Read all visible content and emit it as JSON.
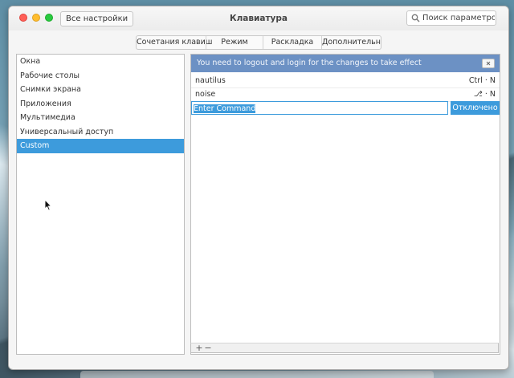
{
  "window": {
    "title": "Клавиатура",
    "back_button": "Все настройки",
    "search_placeholder": "Поиск параметров"
  },
  "tabs": [
    {
      "label": "Сочетания клавиш",
      "selected": true
    },
    {
      "label": "Режим"
    },
    {
      "label": "Раскладка"
    },
    {
      "label": "Дополнительно"
    }
  ],
  "sidebar": {
    "items": [
      {
        "label": "Окна"
      },
      {
        "label": "Рабочие столы"
      },
      {
        "label": "Снимки экрана"
      },
      {
        "label": "Приложения"
      },
      {
        "label": "Мультимедиа"
      },
      {
        "label": "Универсальный доступ"
      },
      {
        "label": "Custom",
        "selected": true
      }
    ]
  },
  "info_bar": {
    "message": "You need to logout and login for the changes to take effect"
  },
  "shortcuts": [
    {
      "name": "nautilus",
      "keys": "Ctrl · N"
    },
    {
      "name": "noise",
      "keys": "⎇ · N"
    },
    {
      "name": "Enter Command",
      "keys": "Отключено"
    }
  ],
  "toolbar": {
    "add_label": "+",
    "remove_label": "−"
  },
  "colors": {
    "accent": "#3d9bdc",
    "info_bar": "#6c91c4"
  }
}
